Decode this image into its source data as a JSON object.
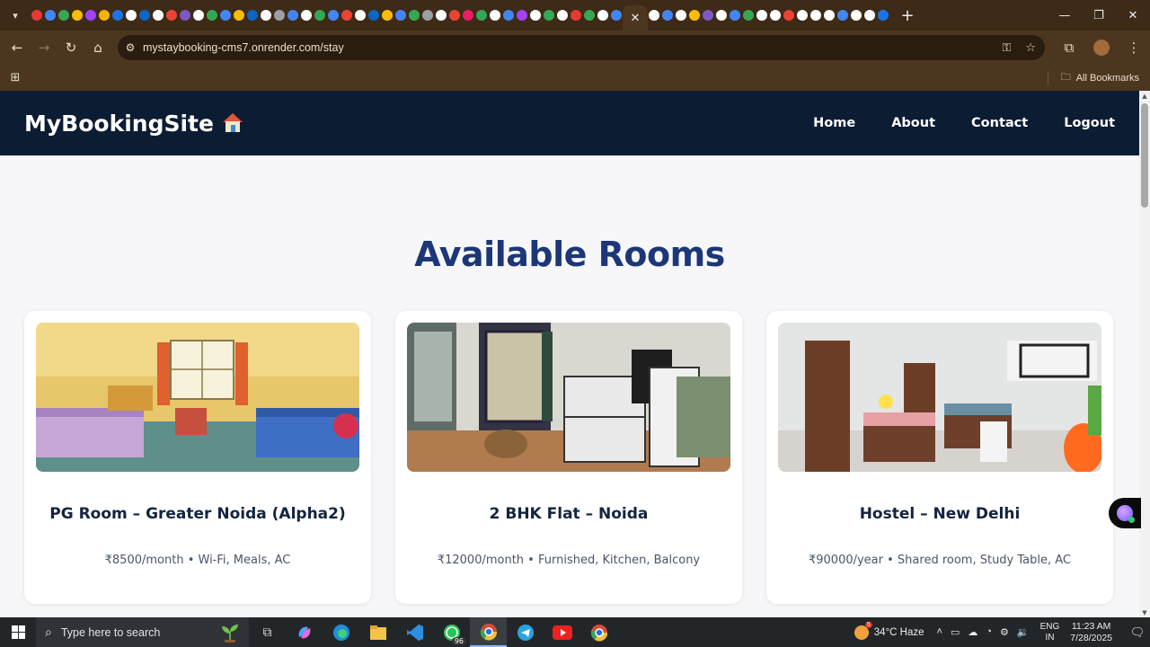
{
  "browser": {
    "url": "mystaybooking-cms7.onrender.com/stay",
    "all_bookmarks_label": "All Bookmarks",
    "tab_close_glyph": "✕",
    "new_tab_glyph": "+",
    "favicon_colors": [
      "#e53935",
      "#4285f4",
      "#34a853",
      "#fbbc05",
      "#a142f4",
      "#f4b400",
      "#1a73e8",
      "#ffffff",
      "#0a66c2",
      "#ffffff",
      "#ea4335",
      "#7e57c2",
      "#ffffff",
      "#34a853",
      "#4285f4",
      "#fbbc05",
      "#0a66c2",
      "#ffffff",
      "#9aa0a6",
      "#4285f4",
      "#ffffff",
      "#34a853",
      "#4285f4",
      "#ea4335",
      "#ffffff",
      "#0a66c2",
      "#fbbc05",
      "#4285f4",
      "#34a853",
      "#9aa0a6",
      "#ffffff",
      "#ea4335",
      "#e91e63",
      "#34a853",
      "#ffffff",
      "#4285f4",
      "#a142f4",
      "#ffffff",
      "#34a853",
      "#ffffff",
      "#e53935",
      "#34a853",
      "#ffffff",
      "#4285f4"
    ],
    "favicon_colors_right": [
      "#ffffff",
      "#4285f4",
      "#ffffff",
      "#fbbc05",
      "#7e57c2",
      "#ffffff",
      "#4285f4",
      "#34a853",
      "#ffffff",
      "#ffffff",
      "#ea4335",
      "#ffffff",
      "#ffffff",
      "#ffffff",
      "#4285f4",
      "#ffffff",
      "#ffffff",
      "#1a73e8"
    ]
  },
  "site": {
    "brand": "MyBookingSite",
    "nav": [
      {
        "label": "Home"
      },
      {
        "label": "About"
      },
      {
        "label": "Contact"
      },
      {
        "label": "Logout"
      }
    ],
    "section_title": "Available Rooms",
    "rooms": [
      {
        "title": "PG Room – Greater Noida (Alpha2)",
        "description": "₹8500/month • Wi-Fi, Meals, AC"
      },
      {
        "title": "2 BHK Flat – Noida",
        "description": "₹12000/month • Furnished, Kitchen, Balcony"
      },
      {
        "title": "Hostel – New Delhi",
        "description": "₹90000/year • Shared room, Study Table, AC"
      }
    ]
  },
  "taskbar": {
    "search_placeholder": "Type here to search",
    "whatsapp_badge": "96",
    "weather_badge": "5",
    "weather": "34°C  Haze",
    "lang_top": "ENG",
    "lang_bottom": "IN",
    "time": "11:23 AM",
    "date": "7/28/2025"
  }
}
